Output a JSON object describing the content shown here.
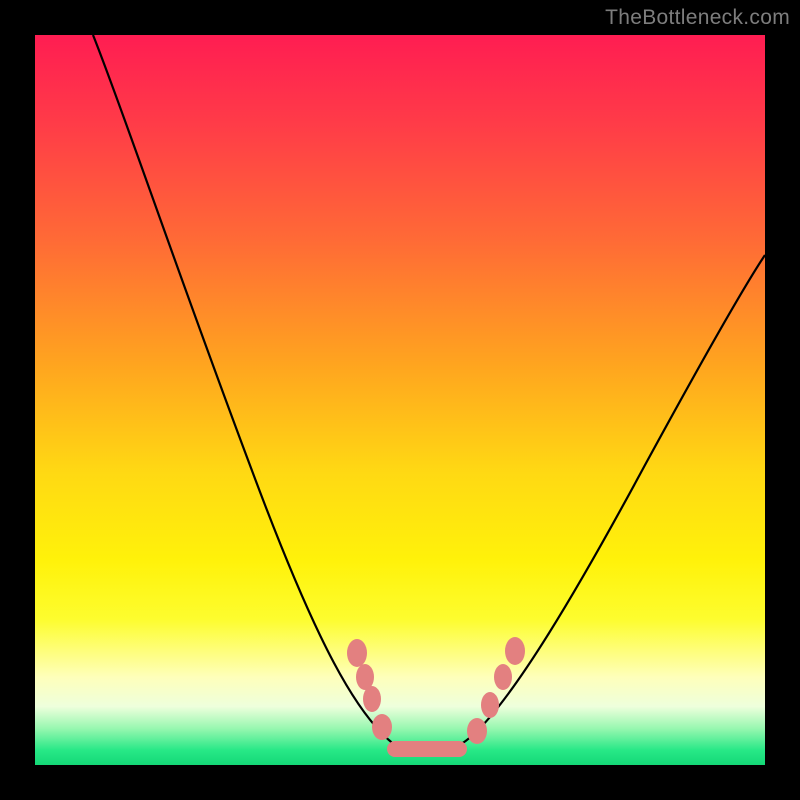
{
  "watermark": "TheBottleneck.com",
  "chart_data": {
    "type": "line",
    "title": "",
    "xlabel": "",
    "ylabel": "",
    "xlim": [
      0,
      100
    ],
    "ylim": [
      0,
      100
    ],
    "series": [
      {
        "name": "curve",
        "x": [
          8,
          12,
          18,
          24,
          30,
          35,
          40,
          44,
          47,
          49,
          51,
          54,
          57,
          60,
          63,
          67,
          72,
          78,
          85,
          92,
          100
        ],
        "y": [
          100,
          90,
          77,
          64,
          50,
          38,
          26,
          16,
          8,
          3,
          1,
          1,
          2,
          6,
          12,
          20,
          30,
          42,
          55,
          68,
          82
        ]
      }
    ],
    "markers": {
      "name": "highlight-dots",
      "color": "#e38080",
      "points": [
        {
          "x": 44.5,
          "y": 16.0
        },
        {
          "x": 45.5,
          "y": 12.5
        },
        {
          "x": 46.5,
          "y": 9.0
        },
        {
          "x": 48.0,
          "y": 4.5
        },
        {
          "x": 50.0,
          "y": 1.5
        },
        {
          "x": 52.5,
          "y": 1.0
        },
        {
          "x": 55.0,
          "y": 1.0
        },
        {
          "x": 57.5,
          "y": 2.5
        },
        {
          "x": 60.0,
          "y": 6.0
        },
        {
          "x": 62.5,
          "y": 11.0
        },
        {
          "x": 64.5,
          "y": 15.5
        }
      ]
    },
    "gradient_bands": [
      {
        "color": "#ff1d52",
        "stop": 0
      },
      {
        "color": "#ffd913",
        "stop": 60
      },
      {
        "color": "#fff20a",
        "stop": 72
      },
      {
        "color": "#feffbb",
        "stop": 88
      },
      {
        "color": "#14d877",
        "stop": 100
      }
    ]
  }
}
